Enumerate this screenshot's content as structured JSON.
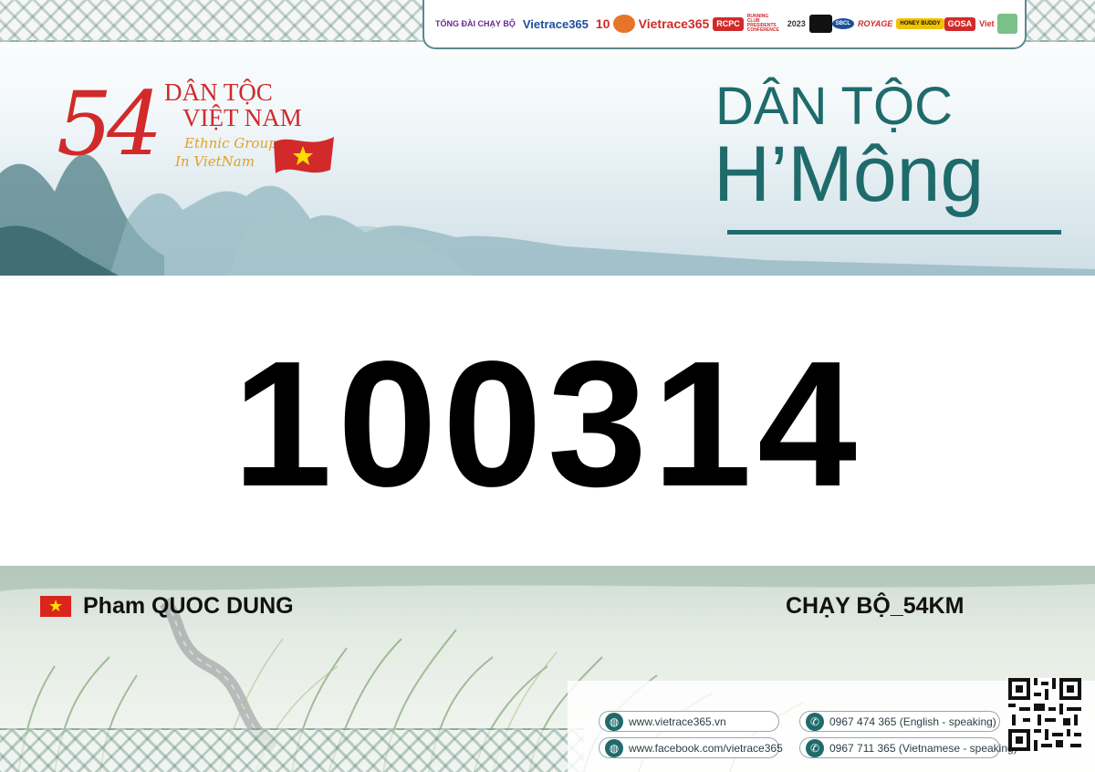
{
  "sponsors": [
    "TỔNG ĐÀI CHẠY BỘ",
    "Vietrace365",
    "10",
    "",
    "Vietrace365",
    "RCPC",
    "RUNNING CLUB PRESIDENTS CONFERENCE",
    "2023",
    "",
    "SBCL",
    "ROYAGE",
    "HONEY BUDDY",
    "GOSA",
    "Viet",
    ""
  ],
  "logo_54": {
    "number": "54",
    "line1": "DÂN TỘC",
    "line2": "VIỆT NAM",
    "sub1": "Ethnic Group",
    "sub2": "In VietNam"
  },
  "ethnic_group": {
    "line1": "DÂN TỘC",
    "line2": "H’Mông"
  },
  "bib_number": "100314",
  "runner": {
    "name": "Pham QUOC DUNG",
    "category": "CHẠY BỘ_54KM"
  },
  "contacts": {
    "website": "www.vietrace365.vn",
    "facebook": "www.facebook.com/vietrace365",
    "phone_en": "0967 474 365 (English - speaking)",
    "phone_vn": "0967 711 365 (Vietnamese - speaking)"
  },
  "colors": {
    "teal": "#1f6b6c",
    "red": "#d22a2a",
    "gold": "#e0a028"
  },
  "icons": {
    "globe": "globe-icon",
    "phone": "phone-icon",
    "qr": "qr-code-icon"
  }
}
